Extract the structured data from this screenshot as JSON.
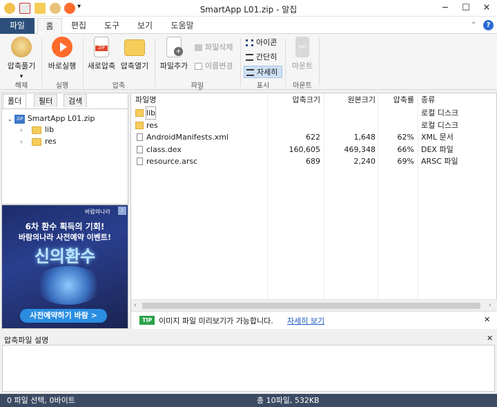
{
  "window": {
    "title": "SmartApp L01.zip - 알집",
    "minimize": "─",
    "maximize": "☐",
    "close": "✕",
    "dropdown": "▾"
  },
  "tabs": [
    "파일",
    "홈",
    "편집",
    "도구",
    "보기",
    "도움말"
  ],
  "ribbon": {
    "extract": "압축풀기",
    "extract_arrow": "▾",
    "run": "바로실행",
    "new_zip": "새로압축",
    "open_zip": "압축열기",
    "add_file": "파일추가",
    "delete_file": "파일삭제",
    "rename": "이름변경",
    "view_icon": "아이콘",
    "view_simple": "간단히",
    "view_detail": "자세히",
    "mount": "마운트",
    "iso": "ISO",
    "groups": {
      "extract": "해제",
      "run": "실행",
      "compress": "압축",
      "file": "파일",
      "view": "표시",
      "mount": "마운트"
    }
  },
  "colors": {
    "file_tab": "#2b4f7a",
    "status": "#3c4b63",
    "accent": "#ff6b2b",
    "link": "#1a56c4",
    "tip": "#2aa24a"
  },
  "left": {
    "tabs": [
      "폴더",
      "필터",
      "검색"
    ],
    "tree": {
      "root": "SmartApp L01.zip",
      "zip_icon": "ZIP",
      "children": [
        "lib",
        "res"
      ]
    }
  },
  "ad": {
    "line1": "6차 환수 획득의 기회!",
    "line2": "바람의나라 사전예약 이벤트!",
    "title": "신의환수",
    "button": "사전예약하기 바람 >",
    "brand": "바람의나라",
    "info": "i"
  },
  "list": {
    "sort_arrow": "^",
    "headers": {
      "name": "파일명",
      "packed": "압축크기",
      "original": "원본크기",
      "ratio": "압축률",
      "type": "종류"
    },
    "rows": [
      {
        "name": "lib",
        "packed": "",
        "original": "",
        "ratio": "",
        "type": "로컬 디스크",
        "folder": true
      },
      {
        "name": "res",
        "packed": "",
        "original": "",
        "ratio": "",
        "type": "로컬 디스크",
        "folder": true
      },
      {
        "name": "AndroidManifests.xml",
        "packed": "622",
        "original": "1,648",
        "ratio": "62%",
        "type": "XML 문서",
        "folder": false
      },
      {
        "name": "class.dex",
        "packed": "160,605",
        "original": "469,348",
        "ratio": "66%",
        "type": "DEX 파일",
        "folder": false
      },
      {
        "name": "resource.arsc",
        "packed": "689",
        "original": "2,240",
        "ratio": "69%",
        "type": "ARSC 파일",
        "folder": false
      }
    ],
    "tip": {
      "badge": "TIP",
      "text": "이미지 파일 미리보기가 가능합니다.",
      "link": "자세히 보기",
      "close": "✕"
    }
  },
  "desc": {
    "title": "압축파일 설명",
    "close": "✕"
  },
  "status": {
    "left": "0 파일 선택, 0바이트",
    "right": "총 10파일, 532KB"
  }
}
